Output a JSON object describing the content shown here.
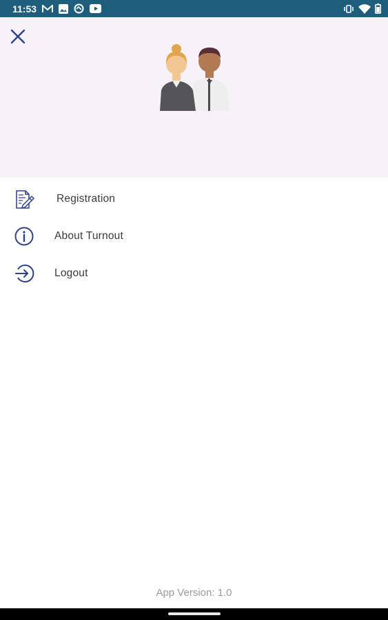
{
  "status_bar": {
    "time": "11:53",
    "icons_left": [
      "gmail-icon",
      "gallery-icon",
      "sync-icon",
      "youtube-icon"
    ],
    "icons_right": [
      "vibrate-icon",
      "wifi-icon",
      "battery-icon"
    ]
  },
  "header": {
    "close_icon": "close-icon",
    "avatar": "users-avatar"
  },
  "menu": {
    "items": [
      {
        "label": "Registration",
        "icon": "registration-icon"
      },
      {
        "label": "About Turnout",
        "icon": "info-icon"
      },
      {
        "label": "Logout",
        "icon": "logout-icon"
      }
    ]
  },
  "footer": {
    "version": "App Version: 1.0"
  },
  "colors": {
    "status_bar": "#1f5d7c",
    "header_bg": "#f7f2f7",
    "icon_blue": "#2b3f8c",
    "text": "#3a3a3a",
    "version_text": "#9a9a9a"
  }
}
